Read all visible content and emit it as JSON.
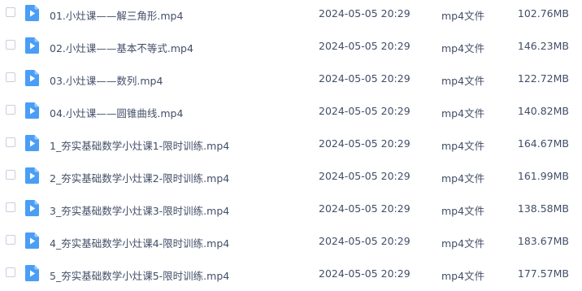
{
  "colors": {
    "icon_blue": "#4a9ef5",
    "text": "#424e67",
    "checkbox_border": "#c9ced9"
  },
  "files": [
    {
      "name": "01.小灶课——解三角形.mp4",
      "time": "2024-05-05 20:29",
      "type": "mp4文件",
      "size": "102.76MB",
      "icon": "video-file-icon"
    },
    {
      "name": "02.小灶课——基本不等式.mp4",
      "time": "2024-05-05 20:29",
      "type": "mp4文件",
      "size": "146.23MB",
      "icon": "video-file-icon"
    },
    {
      "name": "03.小灶课——数列.mp4",
      "time": "2024-05-05 20:29",
      "type": "mp4文件",
      "size": "122.72MB",
      "icon": "video-file-icon"
    },
    {
      "name": "04.小灶课——圆锥曲线.mp4",
      "time": "2024-05-05 20:29",
      "type": "mp4文件",
      "size": "140.82MB",
      "icon": "video-file-icon"
    },
    {
      "name": "1_夯实基础数学小灶课1-限时训练.mp4",
      "time": "2024-05-05 20:29",
      "type": "mp4文件",
      "size": "164.67MB",
      "icon": "video-file-icon"
    },
    {
      "name": "2_夯实基础数学小灶课2-限时训练.mp4",
      "time": "2024-05-05 20:29",
      "type": "mp4文件",
      "size": "161.99MB",
      "icon": "video-file-icon"
    },
    {
      "name": "3_夯实基础数学小灶课3-限时训练.mp4",
      "time": "2024-05-05 20:29",
      "type": "mp4文件",
      "size": "138.58MB",
      "icon": "video-file-icon"
    },
    {
      "name": "4_夯实基础数学小灶课4-限时训练.mp4",
      "time": "2024-05-05 20:29",
      "type": "mp4文件",
      "size": "183.67MB",
      "icon": "video-file-icon"
    },
    {
      "name": "5_夯实基础数学小灶课5-限时训练.mp4",
      "time": "2024-05-05 20:29",
      "type": "mp4文件",
      "size": "177.57MB",
      "icon": "video-file-icon"
    }
  ]
}
